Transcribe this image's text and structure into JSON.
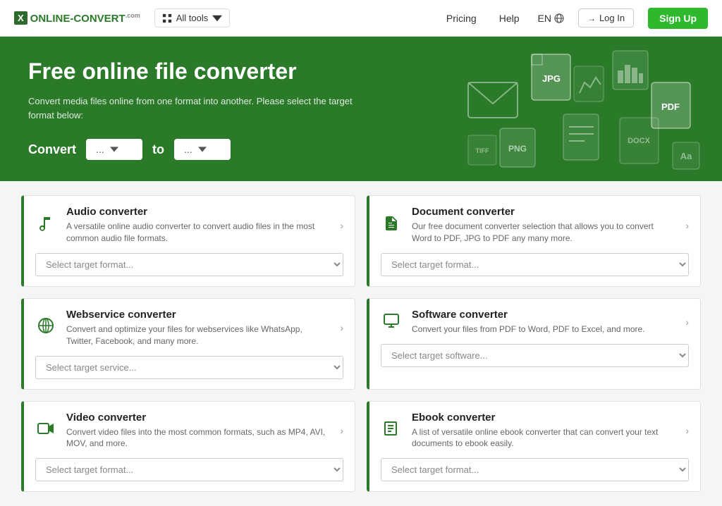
{
  "nav": {
    "logo_icon": "X",
    "logo_name": "ONLINE-CONVERT",
    "logo_suffix": ".com",
    "all_tools_label": "All tools",
    "pricing_label": "Pricing",
    "help_label": "Help",
    "lang_label": "EN",
    "login_label": "Log In",
    "signup_label": "Sign Up"
  },
  "hero": {
    "title": "Free online file converter",
    "subtitle": "Convert media files online from one format into another. Please select the target format below:",
    "convert_label": "Convert",
    "to_label": "to",
    "from_placeholder": "...",
    "to_placeholder": "..."
  },
  "converters": [
    {
      "id": "audio",
      "icon": "♪",
      "title": "Audio converter",
      "desc": "A versatile online audio converter to convert audio files in the most common audio file formats.",
      "select_placeholder": "Select target format..."
    },
    {
      "id": "document",
      "icon": "📄",
      "title": "Document converter",
      "desc": "Our free document converter selection that allows you to convert Word to PDF, JPG to PDF any many more.",
      "select_placeholder": "Select target format..."
    },
    {
      "id": "webservice",
      "icon": "🌐",
      "title": "Webservice converter",
      "desc": "Convert and optimize your files for webservices like WhatsApp, Twitter, Facebook, and many more.",
      "select_placeholder": "Select target service..."
    },
    {
      "id": "software",
      "icon": "💻",
      "title": "Software converter",
      "desc": "Convert your files from PDF to Word, PDF to Excel, and more.",
      "select_placeholder": "Select target software..."
    },
    {
      "id": "video",
      "icon": "🎬",
      "title": "Video converter",
      "desc": "Convert video files into the most common formats, such as MP4, AVI, MOV, and more.",
      "select_placeholder": "Select target format..."
    },
    {
      "id": "ebook",
      "icon": "📚",
      "title": "Ebook converter",
      "desc": "A list of versatile online ebook converter that can convert your text documents to ebook easily.",
      "select_placeholder": "Select target format..."
    }
  ],
  "file_icons": [
    "JPG",
    "PDF",
    "PNG",
    "DOCX",
    "TIFF",
    "Aa"
  ]
}
